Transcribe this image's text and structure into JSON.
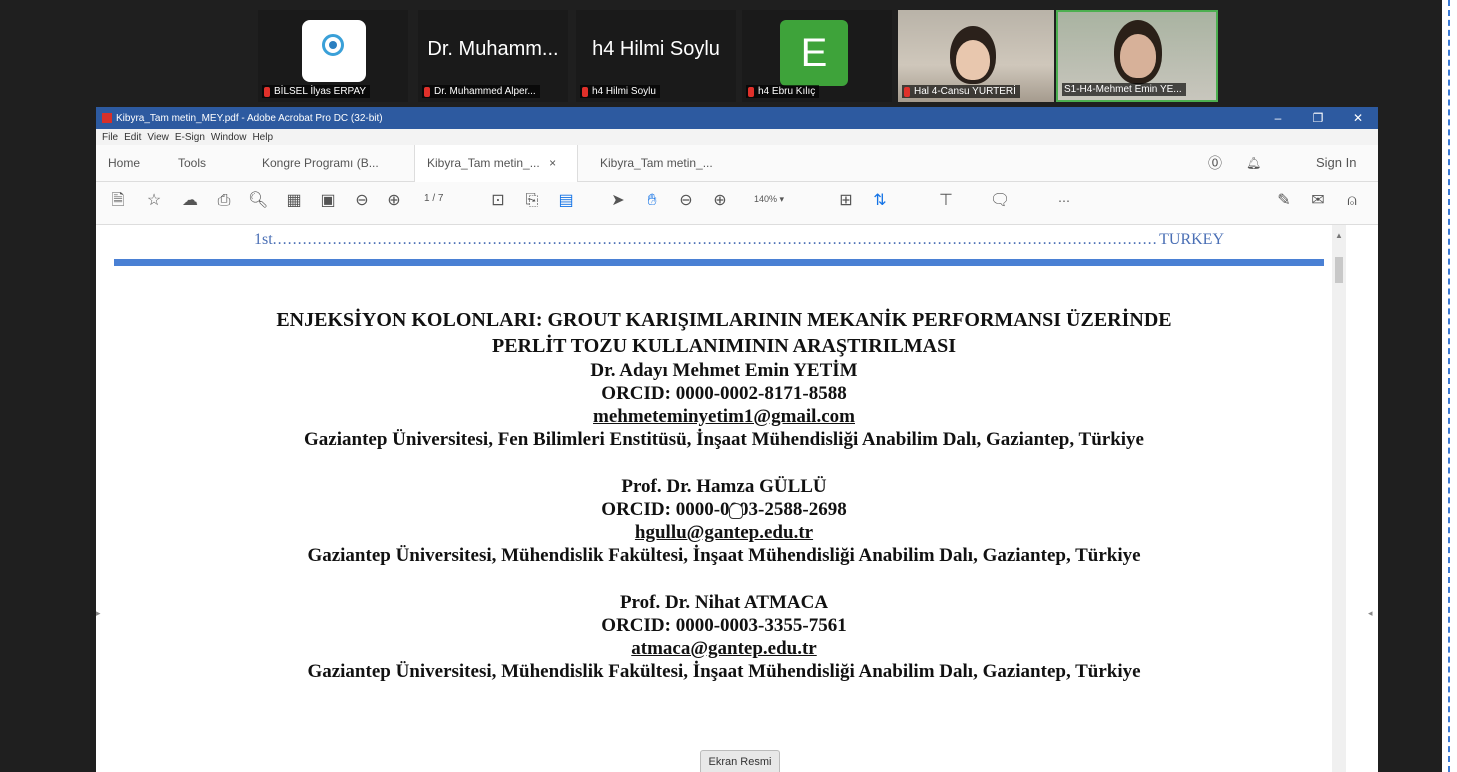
{
  "meeting": {
    "tiles": [
      {
        "name": "BİLSEL İlyas ERPAY",
        "type": "logo"
      },
      {
        "display": "Dr. Muhamm...",
        "name": "Dr. Muhammed Alper...",
        "type": "text"
      },
      {
        "display": "h4 Hilmi Soylu",
        "name": "h4 Hilmi Soylu",
        "type": "text"
      },
      {
        "display": "E",
        "name": "h4 Ebru Kılıç",
        "type": "avatar",
        "color": "#3ea33a"
      },
      {
        "name": "Hal 4-Cansu YURTERİ",
        "type": "video"
      },
      {
        "name": "S1-H4-Mehmet Emin YE...",
        "type": "video",
        "active": true
      }
    ]
  },
  "acrobat": {
    "title": "Kibyra_Tam metin_MEY.pdf - Adobe Acrobat Pro DC (32-bit)",
    "menu": [
      "File",
      "Edit",
      "View",
      "E-Sign",
      "Window",
      "Help"
    ],
    "tabs": {
      "home": "Home",
      "tools": "Tools",
      "doc1": "Kongre Programı (B...",
      "doc2": "Kibyra_Tam metin_...",
      "doc3": "Kibyra_Tam metin_...",
      "sign_in": "Sign In"
    },
    "toolbar": {
      "page_current": "1",
      "page_total": "/ 7",
      "zoom": "140%"
    }
  },
  "document": {
    "header_left": "1st",
    "header_right": "TURKEY",
    "title_line1": "ENJEKSİYON KOLONLARI: GROUT KARIŞIMLARININ MEKANİK PERFORMANSI ÜZERİNDE",
    "title_line2": "PERLİT TOZU KULLANIMININ ARAŞTIRILMASI",
    "authors": [
      {
        "name": "Dr. Adayı Mehmet Emin YETİM",
        "orcid": "ORCID: 0000-0002-8171-8588",
        "email": "mehmeteminyetim1@gmail.com",
        "affiliation": "Gaziantep Üniversitesi, Fen Bilimleri Enstitüsü, İnşaat Mühendisliği Anabilim Dalı, Gaziantep, Türkiye"
      },
      {
        "name": "Prof. Dr. Hamza GÜLLÜ",
        "orcid": "ORCID: 0000-0003-2588-2698",
        "email": "hgullu@gantep.edu.tr",
        "affiliation": "Gaziantep Üniversitesi, Mühendislik Fakültesi, İnşaat Mühendisliği Anabilim Dalı, Gaziantep, Türkiye"
      },
      {
        "name": "Prof. Dr. Nihat ATMACA",
        "orcid": "ORCID: 0000-0003-3355-7561",
        "email": "atmaca@gantep.edu.tr",
        "affiliation": "Gaziantep Üniversitesi, Mühendislik Fakültesi, İnşaat Mühendisliği Anabilim Dalı, Gaziantep, Türkiye"
      }
    ]
  },
  "overlay": {
    "badge": "Ekran Resmi"
  }
}
